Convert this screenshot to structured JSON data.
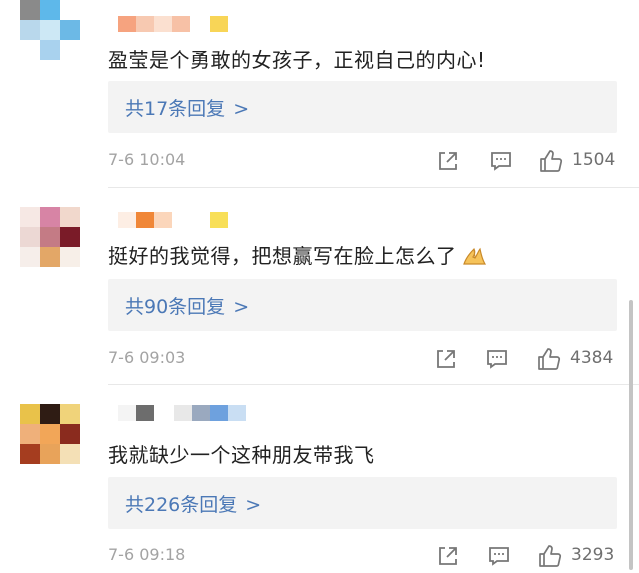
{
  "comments": [
    {
      "text": "盈莹是个勇敢的女孩子，正视自己的内心!",
      "reply_label": "共17条回复",
      "reply_arrow": ">",
      "time": "7-6 10:04",
      "likes": "1504"
    },
    {
      "text": "挺好的我觉得，把想赢写在脸上怎么了",
      "reply_label": "共90条回复",
      "reply_arrow": ">",
      "time": "7-6 09:03",
      "likes": "4384"
    },
    {
      "text": "我就缺少一个这种朋友带我飞",
      "reply_label": "共226条回复",
      "reply_arrow": ">",
      "time": "7-6 09:18",
      "likes": "3293"
    }
  ],
  "icons": {
    "share": "share-icon",
    "comment": "comment-icon",
    "like": "thumbs-up-icon",
    "emoji": "folded-hands-emoji"
  },
  "colors": {
    "reply_link": "#4b78b6",
    "meta": "#a3a3a3",
    "reply_bg": "#f3f3f3"
  }
}
